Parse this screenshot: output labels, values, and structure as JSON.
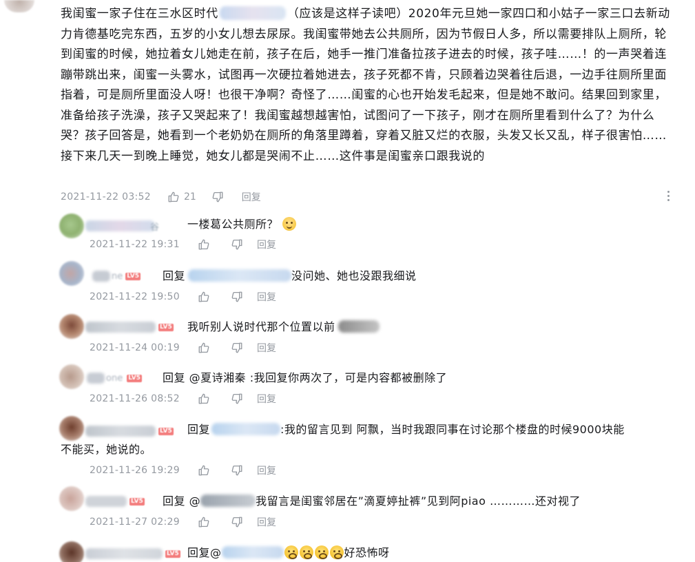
{
  "main": {
    "text_part1": "我闺蜜一家子住在三水区时代",
    "text_part2": "（应该是这样子读吧）2020年元旦她一家四口和小姑子一家三口去新动力肯德基吃完东西，五岁的小女儿想去尿尿。我闺蜜带她去公共厕所，因为节假日人多，所以需要排队上厕所，轮到闺蜜的时候，她拉着女儿她走在前，孩子在后，她手一推门准备拉孩子进去的时候，孩子哇……！的一声哭着连蹦带跳出来，闺蜜一头雾水，试图再一次硬拉着她进去，孩子死都不肯，只顾着边哭着往后退，一边手往厕所里面指着，可是厕所里面没人呀！也很干净啊？奇怪了……闺蜜的心也开始发毛起来，但是她不敢问。结果回到家里，准备给孩子洗澡，孩子又哭起来了！我闺蜜越想越害怕，试图问了一下孩子，刚才在厕所里看到什么了？为什么哭？孩子回答是，她看到一个老奶奶在厕所的角落里蹲着，穿着又脏又烂的衣服，头发又长又乱，样子很害怕……接下来几天一到晚上睡觉，她女儿都是哭闹不止……这件事是闺蜜亲口跟我说的",
    "time": "2021-11-22 03:52",
    "likes": "21",
    "reply_label": "回复"
  },
  "replies": [
    {
      "text": "一楼葛公共厕所？",
      "time": "2021-11-22 19:31",
      "reply_label": "回复",
      "username_fragment": "谷"
    },
    {
      "prefix": "回复",
      "text": "没问她、她也没跟我细说",
      "time": "2021-11-22 19:50",
      "reply_label": "回复",
      "username_fragment": "ne"
    },
    {
      "text": "我听别人说时代那个位置以前",
      "time": "2021-11-24 00:19",
      "reply_label": "回复",
      "username_fragment": ""
    },
    {
      "prefix": "回复",
      "mention": "@夏诗湘秦",
      "text": ":我回复你两次了，可是内容都被删除了",
      "time": "2021-11-26 08:52",
      "reply_label": "回复",
      "username_fragment": "one"
    },
    {
      "prefix": "回复",
      "text_line1": ":我的留言见到 阿飘，当时我跟同事在讨论那个楼盘的时候9000块能",
      "text_line2": "不能买，她说的。",
      "time": "2021-11-26 19:29",
      "reply_label": "回复",
      "username_fragment": ""
    },
    {
      "prefix": "回复",
      "mention": "@",
      "text": "我留言是闺蜜邻居在”滴夏婷扯裤”见到阿piao …………还对视了",
      "time": "2021-11-27 02:29",
      "reply_label": "回复",
      "username_fragment": ""
    },
    {
      "prefix": "回复",
      "mention": "@",
      "text": "好恐怖呀",
      "username_fragment": ""
    }
  ],
  "level_badge": "LV5",
  "icons": [
    "thumb-up-icon",
    "thumb-down-icon",
    "more-vertical-icon",
    "smile-emoji-icon",
    "scared-emoji-icon"
  ],
  "colors": {
    "text": "#18191c",
    "meta": "#9499a0",
    "level_badge": "#f37c7c"
  }
}
